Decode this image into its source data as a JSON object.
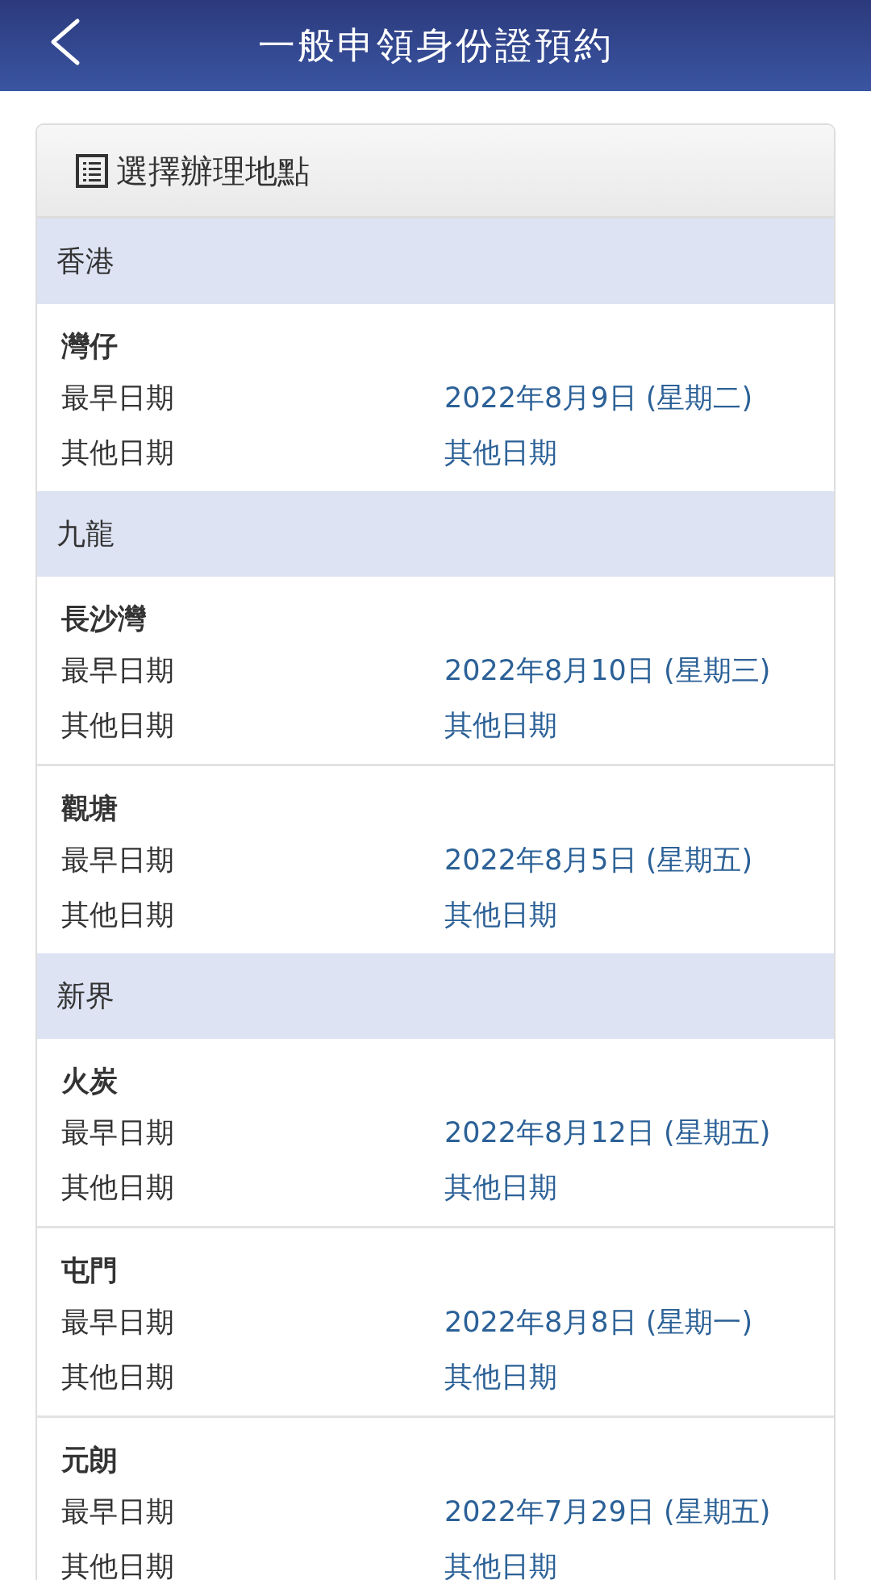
{
  "header": {
    "title": "一般申領身份證預約"
  },
  "card": {
    "title": "選擇辦理地點",
    "regions": [
      {
        "name": "香港",
        "offices": [
          {
            "name": "灣仔",
            "rows": [
              {
                "label": "最早日期",
                "value": "2022年8月9日 (星期二)"
              },
              {
                "label": "其他日期",
                "value": "其他日期"
              }
            ]
          }
        ]
      },
      {
        "name": "九龍",
        "offices": [
          {
            "name": "長沙灣",
            "rows": [
              {
                "label": "最早日期",
                "value": "2022年8月10日 (星期三)"
              },
              {
                "label": "其他日期",
                "value": "其他日期"
              }
            ]
          },
          {
            "name": "觀塘",
            "rows": [
              {
                "label": "最早日期",
                "value": "2022年8月5日 (星期五)"
              },
              {
                "label": "其他日期",
                "value": "其他日期"
              }
            ]
          }
        ]
      },
      {
        "name": "新界",
        "offices": [
          {
            "name": "火炭",
            "rows": [
              {
                "label": "最早日期",
                "value": "2022年8月12日 (星期五)"
              },
              {
                "label": "其他日期",
                "value": "其他日期"
              }
            ]
          },
          {
            "name": "屯門",
            "rows": [
              {
                "label": "最早日期",
                "value": "2022年8月8日 (星期一)"
              },
              {
                "label": "其他日期",
                "value": "其他日期"
              }
            ]
          },
          {
            "name": "元朗",
            "rows": [
              {
                "label": "最早日期",
                "value": "2022年7月29日 (星期五)"
              },
              {
                "label": "其他日期",
                "value": "其他日期"
              }
            ]
          }
        ]
      }
    ]
  }
}
